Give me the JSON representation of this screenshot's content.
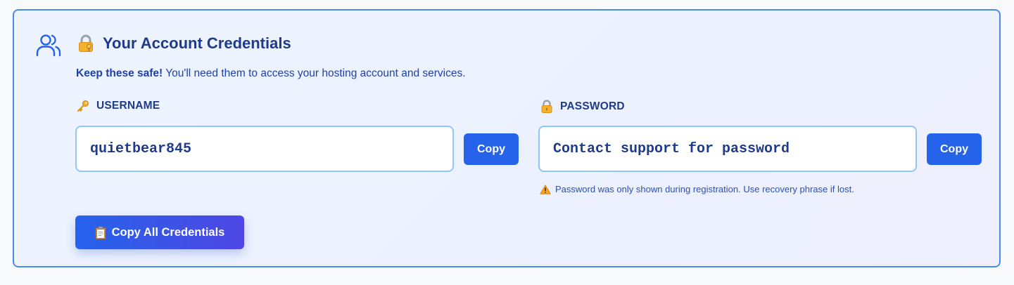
{
  "card": {
    "title": "Your Account Credentials",
    "title_icon": "locked-with-key-icon",
    "header_icon": "users-icon",
    "subtitle_bold": "Keep these safe!",
    "subtitle_rest": " You'll need them to access your hosting account and services."
  },
  "username": {
    "label": "USERNAME",
    "icon": "key-icon",
    "value": "quietbear845",
    "copy_label": "Copy"
  },
  "password": {
    "label": "PASSWORD",
    "icon": "lock-icon",
    "value": "Contact support for password",
    "copy_label": "Copy",
    "warning_icon": "warning-icon",
    "warning": "Password was only shown during registration. Use recovery phrase if lost."
  },
  "copy_all": {
    "icon": "clipboard-icon",
    "label": "Copy All Credentials"
  },
  "colors": {
    "accent": "#2563eb",
    "accent_end": "#4f46e5",
    "title": "#1e3a8a",
    "border": "#4a8ae8",
    "input_border": "#93c5fd"
  }
}
